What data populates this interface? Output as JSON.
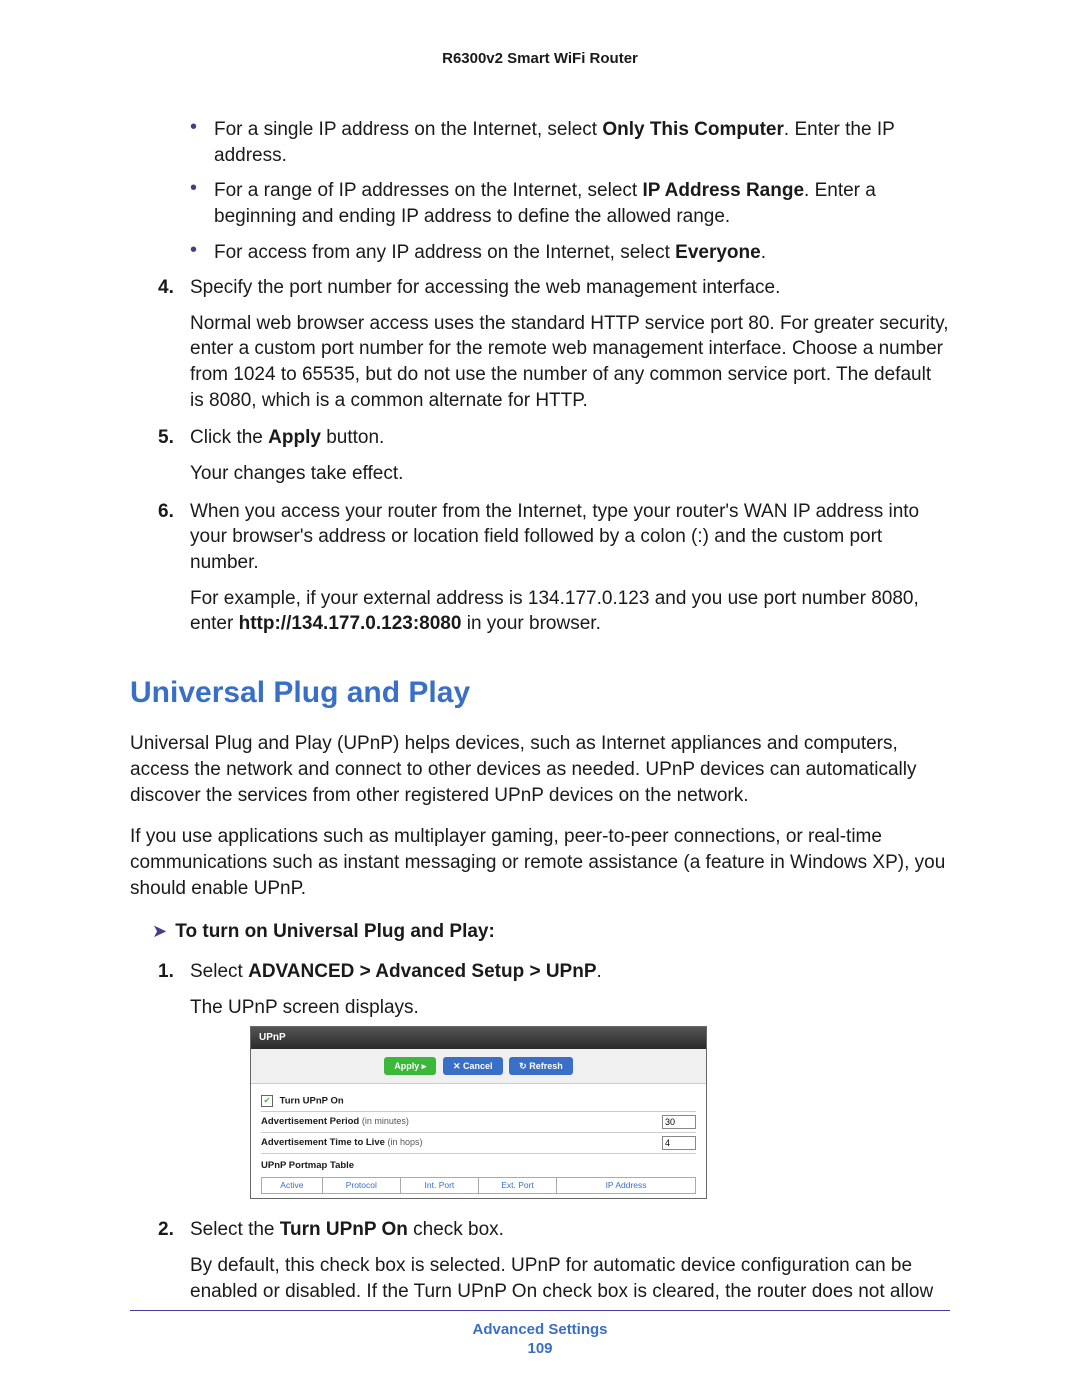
{
  "header": {
    "title": "R6300v2 Smart WiFi Router"
  },
  "bullets": [
    {
      "pre": "For a single IP address on the Internet, select ",
      "bold": "Only This Computer",
      "post": ". Enter the IP address."
    },
    {
      "pre": "For a range of IP addresses on the Internet, select ",
      "bold": "IP Address Range",
      "post": ". Enter a beginning and ending IP address to define the allowed range."
    },
    {
      "pre": "For access from any IP address on the Internet, select ",
      "bold": "Everyone",
      "post": "."
    }
  ],
  "steps_a": {
    "s4": {
      "num": "4.",
      "line": "Specify the port number for accessing the web management interface.",
      "para": "Normal web browser access uses the standard HTTP service port 80. For greater security, enter a custom port number for the remote web management interface. Choose a number from 1024 to 65535, but do not use the number of any common service port. The default is 8080, which is a common alternate for HTTP."
    },
    "s5": {
      "num": "5.",
      "pre": "Click the ",
      "bold": "Apply",
      "post": " button.",
      "para": "Your changes take effect."
    },
    "s6": {
      "num": "6.",
      "line": "When you access your router from the Internet, type your router's WAN IP address into your browser's address or location field followed by a colon (:) and the custom port number.",
      "para_pre": "For example, if your external address is 134.177.0.123 and you use port number 8080, enter ",
      "para_bold": "http://134.177.0.123:8080",
      "para_post": " in your browser."
    }
  },
  "section_heading": "Universal Plug and Play",
  "upnp_para1": "Universal Plug and Play (UPnP) helps devices, such as Internet appliances and computers, access the network and connect to other devices as needed. UPnP devices can automatically discover the services from other registered UPnP devices on the network.",
  "upnp_para2": "If you use applications such as multiplayer gaming, peer-to-peer connections, or real-time communications such as instant messaging or remote assistance (a feature in Windows XP), you should enable UPnP.",
  "procedure_title": "To turn on Universal Plug and Play:",
  "steps_b": {
    "s1": {
      "num": "1.",
      "pre": "Select ",
      "bold": "ADVANCED > Advanced Setup > UPnP",
      "post": ".",
      "para": "The UPnP screen displays."
    },
    "s2": {
      "num": "2.",
      "pre": "Select the ",
      "bold": "Turn UPnP On",
      "post": " check box.",
      "para": "By default, this check box is selected. UPnP for automatic device configuration can be enabled or disabled. If the Turn UPnP On check box is cleared, the router does not allow"
    }
  },
  "upnp_ui": {
    "title": "UPnP",
    "apply": "Apply ▸",
    "cancel": "✕ Cancel",
    "refresh": "↻ Refresh",
    "checkbox_label": "Turn UPnP On",
    "row1_label": "Advertisement Period",
    "row1_units": "(in minutes)",
    "row1_value": "30",
    "row2_label": "Advertisement Time to Live",
    "row2_units": "(in hops)",
    "row2_value": "4",
    "table_title": "UPnP Portmap Table",
    "col1": "Active",
    "col2": "Protocol",
    "col3": "Int. Port",
    "col4": "Ext. Port",
    "col5": "IP Address"
  },
  "footer": {
    "chapter": "Advanced Settings",
    "page": "109"
  }
}
